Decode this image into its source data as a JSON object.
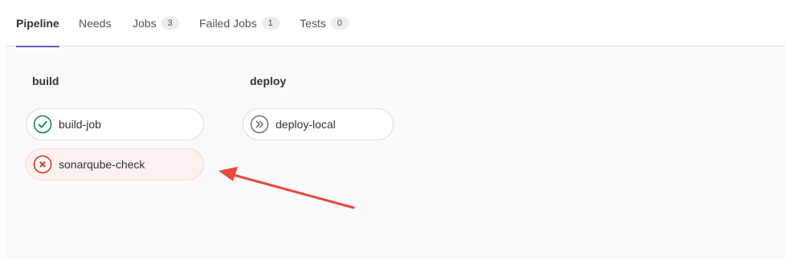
{
  "tabs": [
    {
      "label": "Pipeline",
      "count": null
    },
    {
      "label": "Needs",
      "count": null
    },
    {
      "label": "Jobs",
      "count": "3"
    },
    {
      "label": "Failed Jobs",
      "count": "1"
    },
    {
      "label": "Tests",
      "count": "0"
    }
  ],
  "stages": [
    {
      "name": "build",
      "jobs": [
        {
          "name": "build-job",
          "status": "success",
          "icon": "check-circle-icon"
        },
        {
          "name": "sonarqube-check",
          "status": "failed",
          "icon": "x-circle-icon"
        }
      ]
    },
    {
      "name": "deploy",
      "jobs": [
        {
          "name": "deploy-local",
          "status": "skipped",
          "icon": "skipped-circle-icon"
        }
      ]
    }
  ],
  "colors": {
    "success": "#108548",
    "failed": "#dd2b0e",
    "skipped": "#737278",
    "active_tab": "#6b5ac8",
    "annotation_arrow": "#e8483b"
  }
}
